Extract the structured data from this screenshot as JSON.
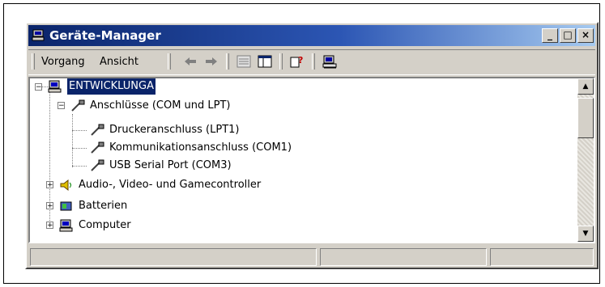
{
  "window": {
    "title": "Geräte-Manager",
    "controls": {
      "minimize": "_",
      "maximize": "□",
      "close": "×"
    }
  },
  "menu": {
    "action": "Vorgang",
    "view": "Ansicht"
  },
  "toolbar": [
    "back-arrow-icon",
    "forward-arrow-icon",
    "properties-icon",
    "console-tree-icon",
    "help-icon",
    "device-manager-icon"
  ],
  "tree": {
    "root": "ENTWICKLUNGA",
    "ports_group": "Anschlüsse (COM und LPT)",
    "ports_children": [
      "Druckeranschluss (LPT1)",
      "Kommunikationsanschluss (COM1)",
      "USB Serial Port (COM3)"
    ],
    "audio": "Audio-, Video- und Gamecontroller",
    "batteries": "Batterien",
    "computer": "Computer"
  },
  "colors": {
    "selection": "#0a246a",
    "title_start": "#0a246a",
    "title_end": "#a6caf0",
    "face": "#d4d0c8"
  }
}
